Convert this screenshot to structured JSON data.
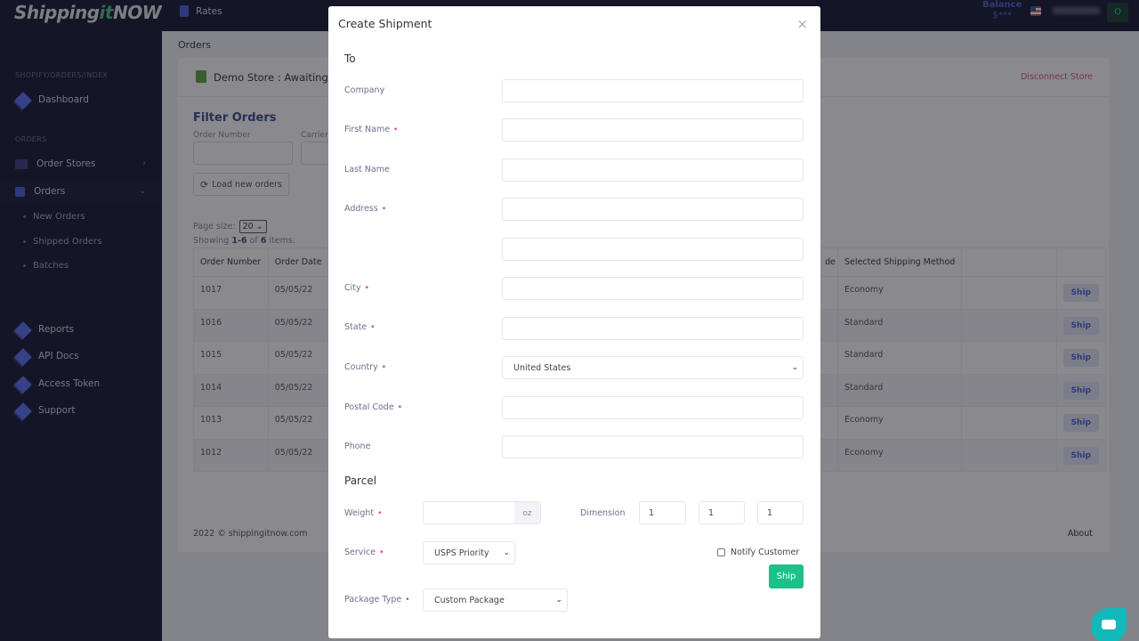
{
  "app": {
    "logo_prefix": "Shipping",
    "logo_accent": "it",
    "logo_suffix": "NOW"
  },
  "topbar": {
    "rates_label": "Rates",
    "balance_label": "Balance",
    "balance_value": "$***",
    "user_button": "O"
  },
  "sidebar": {
    "breadcrumb": "SHOPIFY/ORDERS/INDEX",
    "dashboard": "Dashboard",
    "orders_section": "ORDERS",
    "order_stores": "Order Stores",
    "orders": "Orders",
    "sub_items": [
      "New Orders",
      "Shipped Orders",
      "Batches"
    ],
    "reports": "Reports",
    "api_docs": "API Docs",
    "access_token": "Access Token",
    "support": "Support"
  },
  "main": {
    "page_title": "Orders",
    "store_name": "Demo Store : Awaiting s",
    "disconnect": "Disconnect Store",
    "filter_title": "Filter Orders",
    "filter_order_number": "Order Number",
    "filter_carrier": "Carrier",
    "load_button": "Load new orders",
    "page_size_label": "Page size:",
    "page_size_value": "20",
    "showing_prefix": "Showing",
    "showing_range": "1-6",
    "showing_of": "of",
    "showing_total": "6",
    "showing_suffix": "items.",
    "columns": [
      "Order Number",
      "Order Date",
      "de",
      "Selected Shipping Method"
    ],
    "rows": [
      {
        "number": "1017",
        "date": "05/05/22",
        "method": "Economy",
        "action": "Ship"
      },
      {
        "number": "1016",
        "date": "05/05/22",
        "method": "Standard",
        "action": "Ship"
      },
      {
        "number": "1015",
        "date": "05/05/22",
        "method": "Standard",
        "action": "Ship"
      },
      {
        "number": "1014",
        "date": "05/05/22",
        "method": "Standard",
        "action": "Ship"
      },
      {
        "number": "1013",
        "date": "05/05/22",
        "method": "Economy",
        "action": "Ship"
      },
      {
        "number": "1012",
        "date": "05/05/22",
        "method": "Economy",
        "action": "Ship"
      }
    ],
    "footer_copy": "2022 © shippingitnow.com",
    "footer_about": "About"
  },
  "modal": {
    "title": "Create Shipment",
    "close": "×",
    "to_section": "To",
    "company": "Company",
    "first_name": "First Name",
    "last_name": "Last Name",
    "address": "Address",
    "city": "City",
    "state": "State",
    "country": "Country",
    "country_value": "United States",
    "postal_code": "Postal Code",
    "phone": "Phone",
    "required_mark": "•",
    "parcel_section": "Parcel",
    "weight": "Weight",
    "weight_unit": "oz",
    "dimension": "Dimension",
    "dim_values": [
      "1",
      "1",
      "1"
    ],
    "service": "Service",
    "service_value": "USPS Priority",
    "notify": "Notify Customer",
    "ship": "Ship",
    "package_type": "Package Type",
    "package_value": "Custom Package"
  },
  "colors": {
    "accent": "#4c5fd8",
    "success": "#1ec08a",
    "danger": "#e0406a",
    "sidebar_bg": "#161632"
  }
}
